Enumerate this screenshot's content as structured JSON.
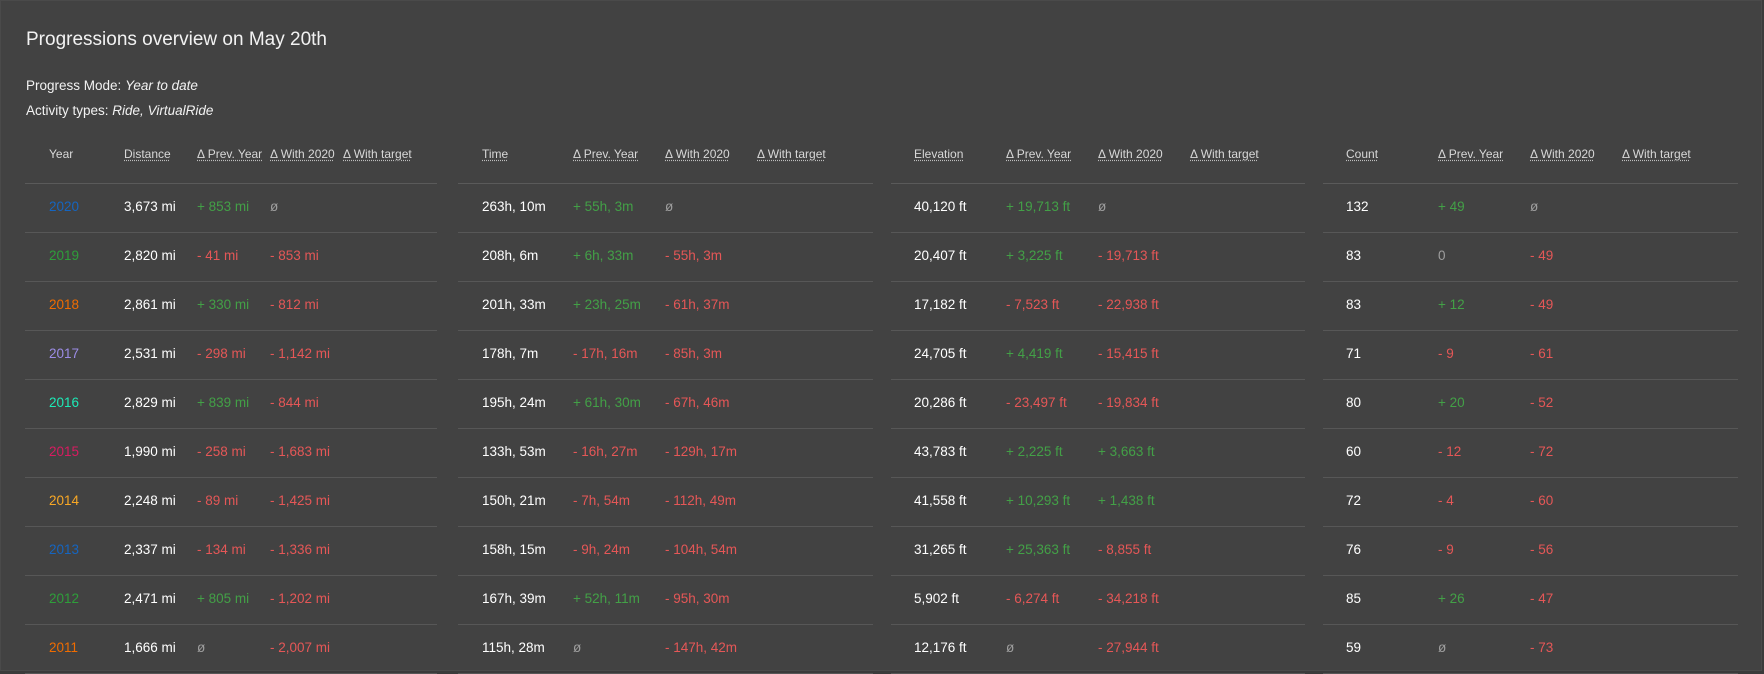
{
  "title": "Progressions overview on May 20th",
  "progress_mode": {
    "label": "Progress Mode:",
    "value": "Year to date"
  },
  "activity_types": {
    "label": "Activity types:",
    "value": "Ride, VirtualRide"
  },
  "year_header": "Year",
  "year_colors": [
    "#1565c0",
    "#2e9e3a",
    "#ef6c00",
    "#9c8ce6",
    "#1de9b6",
    "#d81b60",
    "#f9a825",
    "#1565c0",
    "#2e9e3a",
    "#ef6c00"
  ],
  "sections": [
    {
      "headers": [
        "Distance",
        "Δ Prev. Year",
        "Δ With 2020",
        "Δ With target"
      ],
      "rows": [
        [
          "3,673 mi",
          "+ 853 mi",
          "ø"
        ],
        [
          "2,820 mi",
          "- 41 mi",
          "- 853 mi"
        ],
        [
          "2,861 mi",
          "+ 330 mi",
          "- 812 mi"
        ],
        [
          "2,531 mi",
          "- 298 mi",
          "- 1,142 mi"
        ],
        [
          "2,829 mi",
          "+ 839 mi",
          "- 844 mi"
        ],
        [
          "1,990 mi",
          "- 258 mi",
          "- 1,683 mi"
        ],
        [
          "2,248 mi",
          "- 89 mi",
          "- 1,425 mi"
        ],
        [
          "2,337 mi",
          "- 134 mi",
          "- 1,336 mi"
        ],
        [
          "2,471 mi",
          "+ 805 mi",
          "- 1,202 mi"
        ],
        [
          "1,666 mi",
          "ø",
          "- 2,007 mi"
        ]
      ]
    },
    {
      "headers": [
        "Time",
        "Δ Prev. Year",
        "Δ With 2020",
        "Δ With target"
      ],
      "rows": [
        [
          "263h, 10m",
          "+ 55h, 3m",
          "ø"
        ],
        [
          "208h, 6m",
          "+ 6h, 33m",
          "- 55h, 3m"
        ],
        [
          "201h, 33m",
          "+ 23h, 25m",
          "- 61h, 37m"
        ],
        [
          "178h, 7m",
          "- 17h, 16m",
          "- 85h, 3m"
        ],
        [
          "195h, 24m",
          "+ 61h, 30m",
          "- 67h, 46m"
        ],
        [
          "133h, 53m",
          "- 16h, 27m",
          "- 129h, 17m"
        ],
        [
          "150h, 21m",
          "- 7h, 54m",
          "- 112h, 49m"
        ],
        [
          "158h, 15m",
          "- 9h, 24m",
          "- 104h, 54m"
        ],
        [
          "167h, 39m",
          "+ 52h, 11m",
          "- 95h, 30m"
        ],
        [
          "115h, 28m",
          "ø",
          "- 147h, 42m"
        ]
      ]
    },
    {
      "headers": [
        "Elevation",
        "Δ Prev. Year",
        "Δ With 2020",
        "Δ With target"
      ],
      "rows": [
        [
          "40,120 ft",
          "+ 19,713 ft",
          "ø"
        ],
        [
          "20,407 ft",
          "+ 3,225 ft",
          "- 19,713 ft"
        ],
        [
          "17,182 ft",
          "- 7,523 ft",
          "- 22,938 ft"
        ],
        [
          "24,705 ft",
          "+ 4,419 ft",
          "- 15,415 ft"
        ],
        [
          "20,286 ft",
          "- 23,497 ft",
          "- 19,834 ft"
        ],
        [
          "43,783 ft",
          "+ 2,225 ft",
          "+ 3,663 ft"
        ],
        [
          "41,558 ft",
          "+ 10,293 ft",
          "+ 1,438 ft"
        ],
        [
          "31,265 ft",
          "+ 25,363 ft",
          "- 8,855 ft"
        ],
        [
          "5,902 ft",
          "- 6,274 ft",
          "- 34,218 ft"
        ],
        [
          "12,176 ft",
          "ø",
          "- 27,944 ft"
        ]
      ]
    },
    {
      "headers": [
        "Count",
        "Δ Prev. Year",
        "Δ With 2020",
        "Δ With target"
      ],
      "rows": [
        [
          "132",
          "+ 49",
          "ø"
        ],
        [
          "83",
          "0",
          "- 49"
        ],
        [
          "83",
          "+ 12",
          "- 49"
        ],
        [
          "71",
          "- 9",
          "- 61"
        ],
        [
          "80",
          "+ 20",
          "- 52"
        ],
        [
          "60",
          "- 12",
          "- 72"
        ],
        [
          "72",
          "- 4",
          "- 60"
        ],
        [
          "76",
          "- 9",
          "- 56"
        ],
        [
          "85",
          "+ 26",
          "- 47"
        ],
        [
          "59",
          "ø",
          "- 73"
        ]
      ]
    }
  ],
  "years": [
    "2020",
    "2019",
    "2018",
    "2017",
    "2016",
    "2015",
    "2014",
    "2013",
    "2012",
    "2011"
  ]
}
